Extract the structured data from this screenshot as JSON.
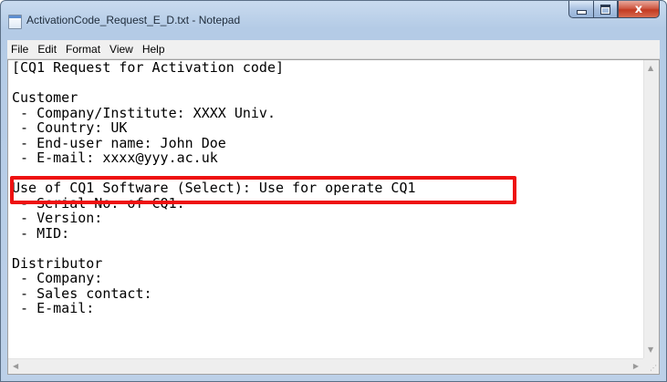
{
  "window": {
    "title": "ActivationCode_Request_E_D.txt - Notepad",
    "controls": {
      "close_label": "x"
    }
  },
  "menubar": [
    "File",
    "Edit",
    "Format",
    "View",
    "Help"
  ],
  "document": {
    "lines": [
      "[CQ1 Request for Activation code]",
      "",
      "Customer",
      " - Company/Institute: XXXX Univ.",
      " - Country: UK",
      " - End-user name: John Doe",
      " - E-mail: xxxx@yyy.ac.uk",
      "",
      "Use of CQ1 Software (Select): Use for operate CQ1",
      " - Serial No. of CQ1:",
      " - Version:",
      " - MID:",
      "",
      "Distributor",
      " - Company:",
      " - Sales contact:",
      " - E-mail:"
    ]
  },
  "annotation": {
    "color": "#ee1111",
    "highlighted_line": 8
  },
  "icons": [
    "notepad-app-icon",
    "minimize-icon",
    "maximize-icon",
    "close-icon",
    "scroll-up-icon",
    "scroll-down-icon",
    "scroll-left-icon",
    "scroll-right-icon",
    "resize-grip-icon"
  ]
}
